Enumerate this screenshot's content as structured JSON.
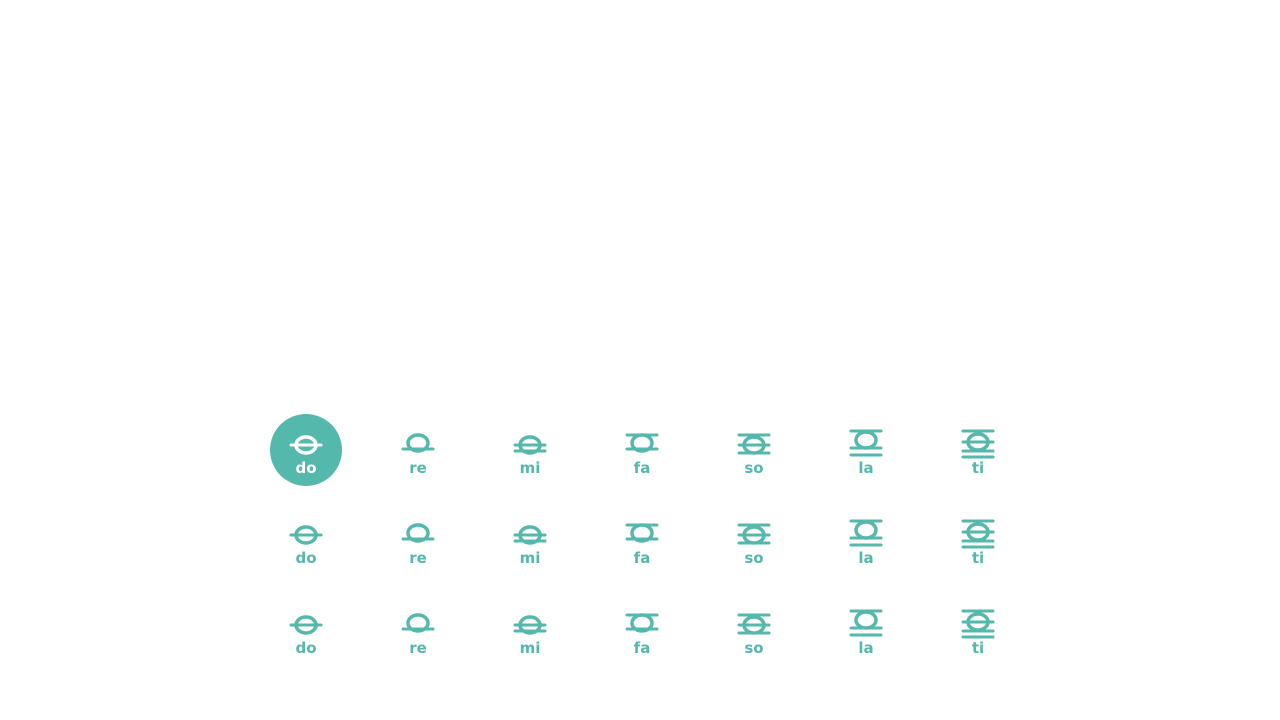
{
  "colors": {
    "accent": "#55b8ac",
    "background": "#ffffff"
  },
  "selected_note": "do",
  "rows": [
    [
      {
        "label": "do",
        "icon": "note-do-icon"
      },
      {
        "label": "re",
        "icon": "note-re-icon"
      },
      {
        "label": "mi",
        "icon": "note-mi-icon"
      },
      {
        "label": "fa",
        "icon": "note-fa-icon"
      },
      {
        "label": "so",
        "icon": "note-so-icon"
      },
      {
        "label": "la",
        "icon": "note-la-icon"
      },
      {
        "label": "ti",
        "icon": "note-ti-icon"
      }
    ],
    [
      {
        "label": "do",
        "icon": "note-do-icon"
      },
      {
        "label": "re",
        "icon": "note-re-icon"
      },
      {
        "label": "mi",
        "icon": "note-mi-icon"
      },
      {
        "label": "fa",
        "icon": "note-fa-icon"
      },
      {
        "label": "so",
        "icon": "note-so-icon"
      },
      {
        "label": "la",
        "icon": "note-la-icon"
      },
      {
        "label": "ti",
        "icon": "note-ti-icon"
      }
    ],
    [
      {
        "label": "do",
        "icon": "note-do-icon"
      },
      {
        "label": "re",
        "icon": "note-re-icon"
      },
      {
        "label": "mi",
        "icon": "note-mi-icon"
      },
      {
        "label": "fa",
        "icon": "note-fa-icon"
      },
      {
        "label": "so",
        "icon": "note-so-icon"
      },
      {
        "label": "la",
        "icon": "note-la-icon"
      },
      {
        "label": "ti",
        "icon": "note-ti-icon"
      }
    ]
  ]
}
